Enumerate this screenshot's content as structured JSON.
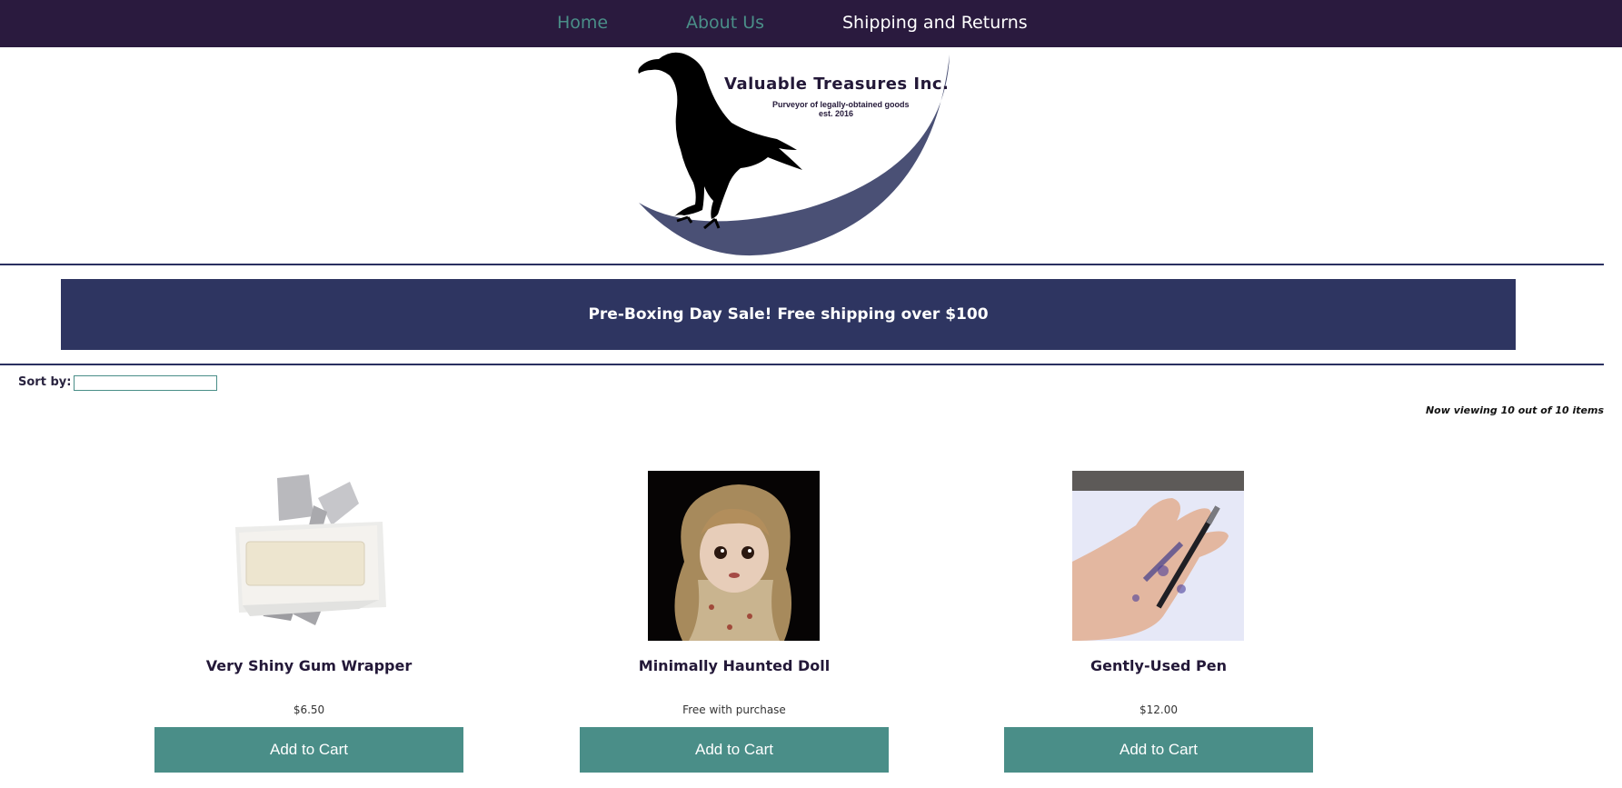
{
  "nav": {
    "home": "Home",
    "about": "About Us",
    "shipping": "Shipping and Returns"
  },
  "logo": {
    "title": "Valuable Treasures Inc.",
    "tagline": "Purveyor of legally-obtained goods",
    "established": "est. 2016"
  },
  "banner": {
    "text": "Pre-Boxing Day Sale! Free shipping over $100"
  },
  "sort": {
    "label": "Sort by:",
    "value": ""
  },
  "viewing": "Now viewing 10 out of 10 items",
  "products": [
    {
      "name": "Very Shiny Gum Wrapper",
      "price": "$6.50",
      "button": "Add to Cart"
    },
    {
      "name": "Minimally Haunted Doll",
      "price": "Free with purchase",
      "button": "Add to Cart"
    },
    {
      "name": "Gently-Used Pen",
      "price": "$12.00",
      "button": "Add to Cart"
    }
  ],
  "colors": {
    "nav_bg": "#2a1a3e",
    "accent_teal": "#4a8e88",
    "banner_bg": "#2e3561",
    "logo_crescent": "#4a5075"
  }
}
